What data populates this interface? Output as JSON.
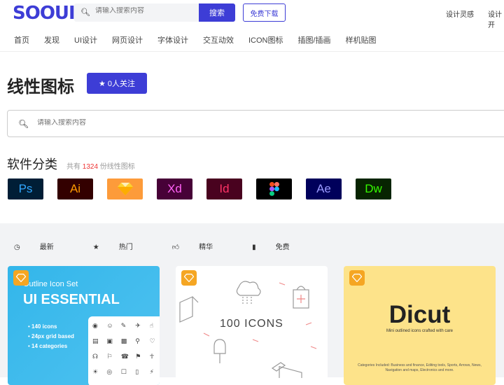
{
  "header": {
    "logo": "SOOUI",
    "search_placeholder": "请输入搜索内容",
    "search_button": "搜索",
    "free_download": "免费下载",
    "right_links": [
      "设计灵感",
      "设计开"
    ]
  },
  "nav": [
    "首页",
    "发现",
    "UI设计",
    "网页设计",
    "字体设计",
    "交互动效",
    "ICON图标",
    "插图/插画",
    "样机贴图"
  ],
  "page": {
    "title": "线性图标",
    "follow_label": "0人关注",
    "search_placeholder": "请输入搜索内容"
  },
  "software": {
    "title": "软件分类",
    "count_prefix": "共有",
    "count": "1324",
    "count_suffix": "份线性图标",
    "apps": [
      {
        "label": "Ps",
        "bg": "#001e36",
        "fg": "#31a8ff",
        "icon": "photoshop-icon"
      },
      {
        "label": "Ai",
        "bg": "#330000",
        "fg": "#ff9a00",
        "icon": "illustrator-icon"
      },
      {
        "label": "",
        "bg": "#fd9b3a",
        "fg": "#fff",
        "icon": "sketch-icon"
      },
      {
        "label": "Xd",
        "bg": "#470137",
        "fg": "#ff61f6",
        "icon": "xd-icon"
      },
      {
        "label": "Id",
        "bg": "#49021f",
        "fg": "#ff3366",
        "icon": "indesign-icon"
      },
      {
        "label": "",
        "bg": "#000000",
        "fg": "#fff",
        "icon": "figma-icon"
      },
      {
        "label": "Ae",
        "bg": "#00005b",
        "fg": "#9999ff",
        "icon": "aftereffects-icon"
      },
      {
        "label": "Dw",
        "bg": "#072401",
        "fg": "#35fa00",
        "icon": "dreamweaver-icon"
      }
    ]
  },
  "filters": [
    "最新",
    "热门",
    "精华",
    "免费"
  ],
  "cards": [
    {
      "line1": "Outline Icon Set",
      "line2": "UI ESSENTIAL",
      "features": [
        "140 icons",
        "24px grid based",
        "14 categories"
      ]
    },
    {
      "title": "100 ICONS"
    },
    {
      "title": "Dicut",
      "subtitle": "Mini outlined icons crafted with care",
      "footnote": "Categories Included: Business and finance, Editing tools, Sports, Arrows, News, Navigation and maps, Electronics and more."
    }
  ]
}
